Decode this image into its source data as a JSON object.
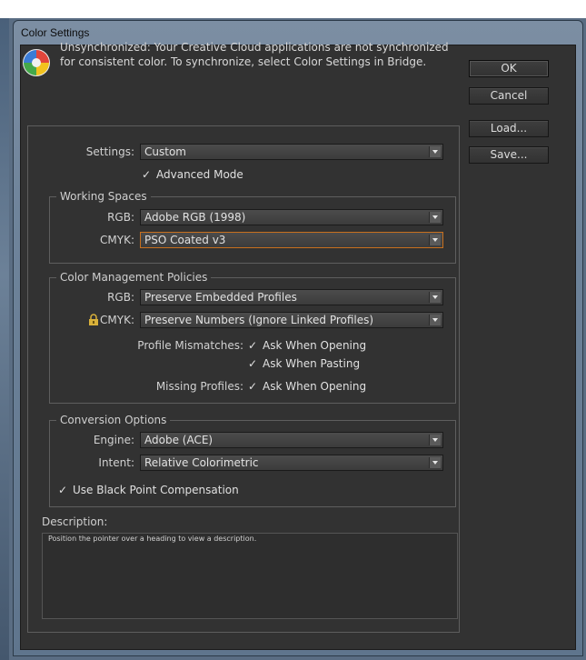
{
  "window": {
    "title": "Color Settings"
  },
  "message": {
    "icon": "color-wheel-icon",
    "text": "Unsynchronized: Your Creative Cloud applications are not synchronized for consistent color. To synchronize, select Color Settings in Bridge."
  },
  "buttons": {
    "ok": "OK",
    "cancel": "Cancel",
    "load": "Load...",
    "save": "Save..."
  },
  "settings": {
    "label": "Settings:",
    "value": "Custom",
    "advanced_mode": "Advanced Mode"
  },
  "working_spaces": {
    "title": "Working Spaces",
    "rgb_label": "RGB:",
    "rgb_value": "Adobe RGB (1998)",
    "cmyk_label": "CMYK:",
    "cmyk_value": "PSO Coated v3"
  },
  "policies": {
    "title": "Color Management Policies",
    "rgb_label": "RGB:",
    "rgb_value": "Preserve Embedded Profiles",
    "cmyk_label": "CMYK:",
    "cmyk_value": "Preserve Numbers (Ignore Linked Profiles)",
    "lock_icon": "lock-icon",
    "mismatch_label": "Profile Mismatches:",
    "ask_opening": "Ask When Opening",
    "ask_pasting": "Ask When Pasting",
    "missing_label": "Missing Profiles:",
    "missing_ask_opening": "Ask When Opening"
  },
  "conversion": {
    "title": "Conversion Options",
    "engine_label": "Engine:",
    "engine_value": "Adobe (ACE)",
    "intent_label": "Intent:",
    "intent_value": "Relative Colorimetric",
    "black_point": "Use Black Point Compensation"
  },
  "description": {
    "label": "Description:",
    "text": "Position the pointer over a heading to view a description."
  },
  "colors": {
    "dialog_bg": "#323232",
    "focus_border": "#c7701e"
  }
}
